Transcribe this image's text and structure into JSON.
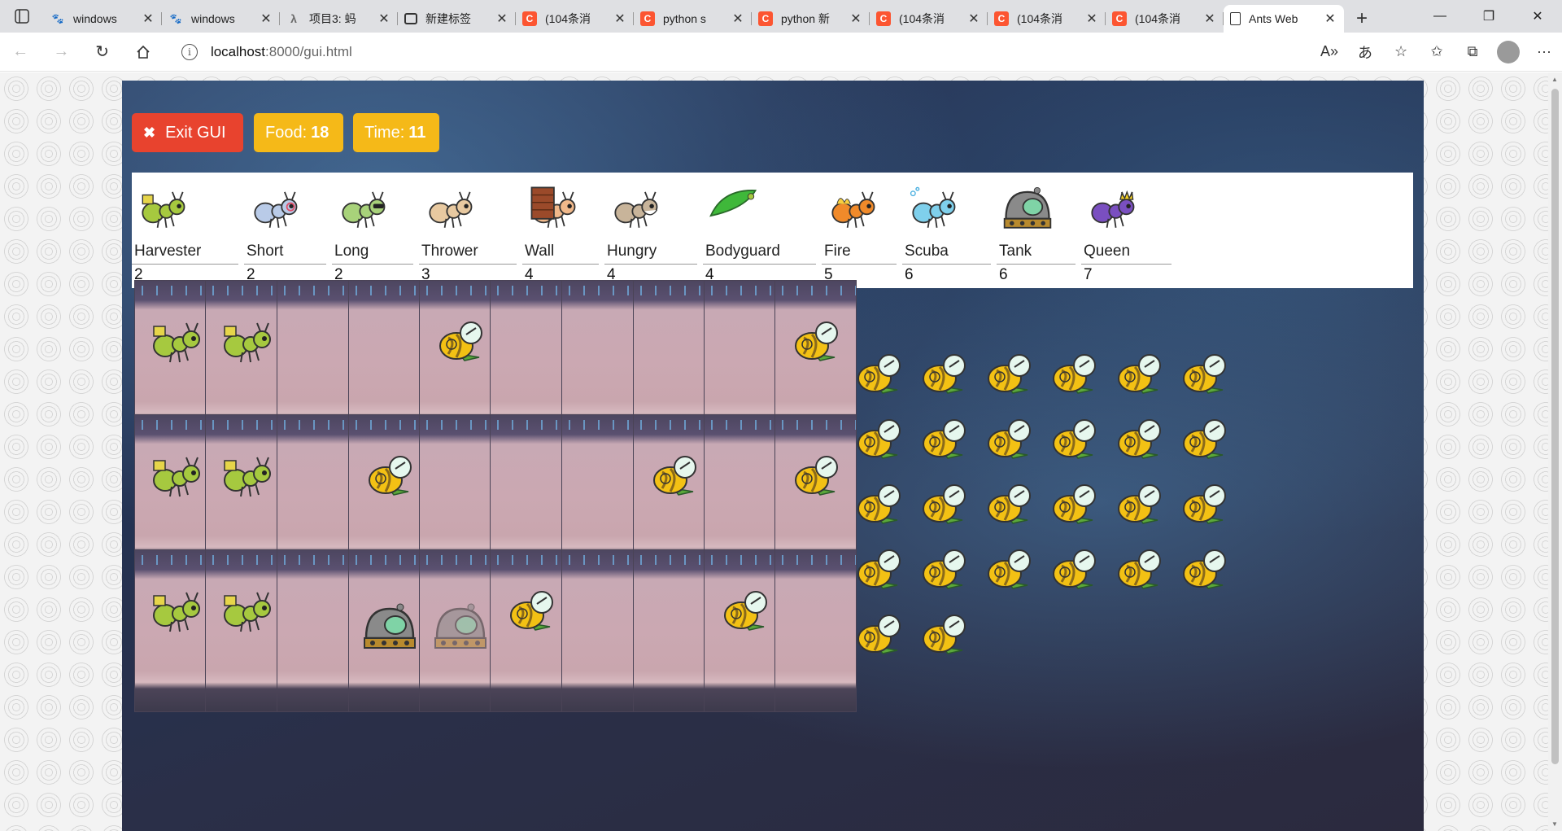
{
  "browser": {
    "tabs": [
      {
        "title": "windows",
        "favicon": "baidu-paw-icon"
      },
      {
        "title": "windows",
        "favicon": "baidu-paw-icon"
      },
      {
        "title": "项目3: 蚂",
        "favicon": "lambda-icon"
      },
      {
        "title": "新建标签",
        "favicon": "new-tab-icon"
      },
      {
        "title": "(104条消",
        "favicon": "csdn-icon"
      },
      {
        "title": "python s",
        "favicon": "csdn-icon"
      },
      {
        "title": "python 新",
        "favicon": "csdn-icon"
      },
      {
        "title": "(104条消",
        "favicon": "csdn-icon"
      },
      {
        "title": "(104条消",
        "favicon": "csdn-icon"
      },
      {
        "title": "(104条消",
        "favicon": "csdn-icon"
      },
      {
        "title": "Ants Web",
        "favicon": "document-icon",
        "active": true
      }
    ],
    "url_host": "localhost",
    "url_path": ":8000/gui.html"
  },
  "controls": {
    "exit_label": "Exit GUI",
    "food_label": "Food:",
    "food_value": "18",
    "time_label": "Time:",
    "time_value": "11"
  },
  "ant_types": [
    {
      "name": "Harvester",
      "cost": "2",
      "icon": "harvester-ant-icon",
      "color": "#a6c93f"
    },
    {
      "name": "Short",
      "cost": "2",
      "icon": "short-thrower-ant-icon",
      "color": "#b9cbe8"
    },
    {
      "name": "Long",
      "cost": "2",
      "icon": "long-thrower-ant-icon",
      "color": "#a8d27a"
    },
    {
      "name": "Thrower",
      "cost": "3",
      "icon": "thrower-ant-icon",
      "color": "#e8c9a0"
    },
    {
      "name": "Wall",
      "cost": "4",
      "icon": "wall-ant-icon",
      "color": "#f0b88a"
    },
    {
      "name": "Hungry",
      "cost": "4",
      "icon": "hungry-ant-icon",
      "color": "#c8b49a"
    },
    {
      "name": "Bodyguard",
      "cost": "4",
      "icon": "bodyguard-leaf-icon",
      "color": "#3fb83a"
    },
    {
      "name": "Fire",
      "cost": "5",
      "icon": "fire-ant-icon",
      "color": "#f08a2a"
    },
    {
      "name": "Scuba",
      "cost": "6",
      "icon": "scuba-ant-icon",
      "color": "#7fd0ec"
    },
    {
      "name": "Tank",
      "cost": "6",
      "icon": "tank-ant-icon",
      "color": "#8a8a8a"
    },
    {
      "name": "Queen",
      "cost": "7",
      "icon": "queen-ant-icon",
      "color": "#7a4fc0"
    }
  ],
  "board": {
    "rows": 3,
    "cols": 10,
    "occupants": [
      {
        "row": 0,
        "col": 0,
        "type": "harvester"
      },
      {
        "row": 0,
        "col": 1,
        "type": "harvester"
      },
      {
        "row": 0,
        "col": 4,
        "type": "bee"
      },
      {
        "row": 0,
        "col": 9,
        "type": "bee"
      },
      {
        "row": 1,
        "col": 0,
        "type": "harvester"
      },
      {
        "row": 1,
        "col": 1,
        "type": "harvester"
      },
      {
        "row": 1,
        "col": 3,
        "type": "bee"
      },
      {
        "row": 1,
        "col": 7,
        "type": "bee"
      },
      {
        "row": 1,
        "col": 9,
        "type": "bee"
      },
      {
        "row": 2,
        "col": 0,
        "type": "harvester"
      },
      {
        "row": 2,
        "col": 1,
        "type": "harvester"
      },
      {
        "row": 2,
        "col": 3,
        "type": "tank"
      },
      {
        "row": 2,
        "col": 4,
        "type": "tank-ghost"
      },
      {
        "row": 2,
        "col": 5,
        "type": "bee"
      },
      {
        "row": 2,
        "col": 8,
        "type": "bee"
      }
    ],
    "hive_bee_count": 26
  }
}
